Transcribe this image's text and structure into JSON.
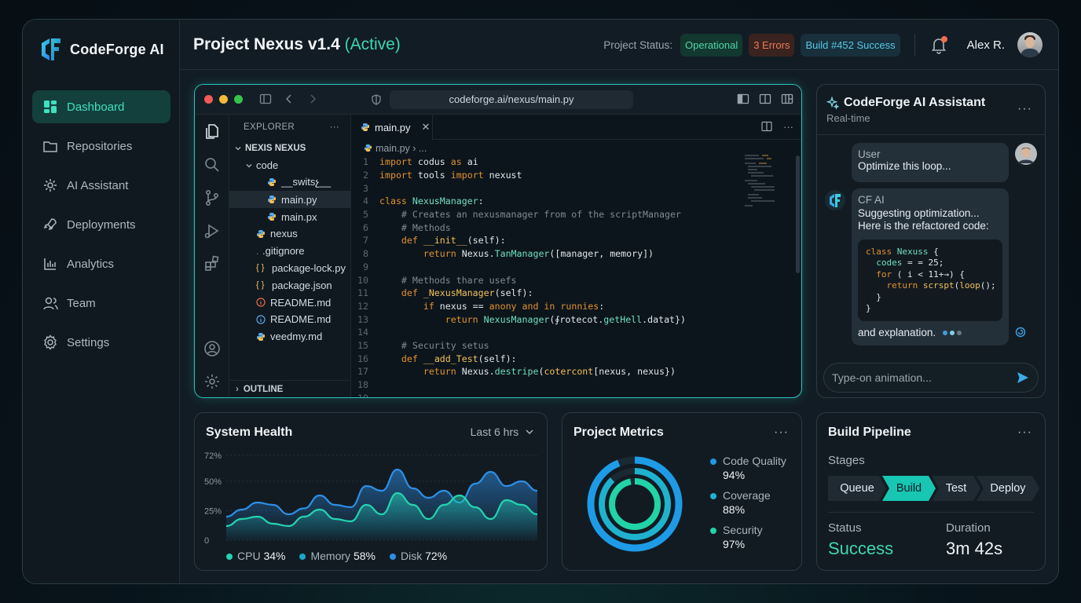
{
  "app": {
    "name": "CodeForge AI"
  },
  "sidebar": {
    "items": [
      {
        "label": "Dashboard",
        "icon": "dashboard-icon",
        "active": true
      },
      {
        "label": "Repositories",
        "icon": "folder-icon"
      },
      {
        "label": "AI Assistant",
        "icon": "cpu-icon"
      },
      {
        "label": "Deployments",
        "icon": "rocket-icon"
      },
      {
        "label": "Analytics",
        "icon": "bar-chart-icon"
      },
      {
        "label": "Team",
        "icon": "users-icon"
      },
      {
        "label": "Settings",
        "icon": "gear-icon"
      }
    ]
  },
  "header": {
    "title": "Project Nexus v1.4",
    "title_status": "(Active)",
    "status_label": "Project Status:",
    "badges": {
      "operational": "Operational",
      "errors": "3 Errors",
      "build": "Build #452 Success"
    },
    "user_name": "Alex R."
  },
  "editor": {
    "url": "codeforge.ai/nexus/main.py",
    "explorer_title": "EXPLORER",
    "explorer_menu": "···",
    "tree": [
      {
        "label": "NEXIS NEXUS",
        "depth": 0,
        "type": "root"
      },
      {
        "label": "code",
        "depth": 1,
        "type": "folder"
      },
      {
        "label": "__switsչ__",
        "depth": 2,
        "type": "py"
      },
      {
        "label": "main.py",
        "depth": 2,
        "type": "py",
        "selected": true
      },
      {
        "label": "main.px",
        "depth": 2,
        "type": "py"
      },
      {
        "label": "nexus",
        "depth": 1,
        "type": "py"
      },
      {
        "label": ".gitignore",
        "depth": 1,
        "type": "git"
      },
      {
        "label": "package-lock.py",
        "depth": 1,
        "type": "json"
      },
      {
        "label": "package.json",
        "depth": 1,
        "type": "json"
      },
      {
        "label": "README.md",
        "depth": 1,
        "type": "readme-red"
      },
      {
        "label": "README.md",
        "depth": 1,
        "type": "readme-blue"
      },
      {
        "label": "veedmy.md",
        "depth": 1,
        "type": "py"
      }
    ],
    "outline_label": "OUTLINE",
    "tab_label": "main.py",
    "tab_close": "✕",
    "tab_more": "···",
    "breadcrumb": "main.py › ...",
    "code_lines": [
      [
        [
          "kw",
          "import"
        ],
        [
          "pl",
          " codus "
        ],
        [
          "kw",
          "as"
        ],
        [
          "pl",
          " ai"
        ]
      ],
      [
        [
          "kw",
          "import"
        ],
        [
          "pl",
          " tools "
        ],
        [
          "kw",
          "import"
        ],
        [
          "pl",
          " nexust"
        ]
      ],
      [],
      [
        [
          "kw",
          "class"
        ],
        [
          "pl",
          " "
        ],
        [
          "cl",
          "NexusManager"
        ],
        [
          "pl",
          ":"
        ]
      ],
      [
        [
          "pl",
          "    "
        ],
        [
          "cm",
          "# Creates an nexusmanager from of the scriptManager"
        ]
      ],
      [
        [
          "pl",
          "    "
        ],
        [
          "cm",
          "# Methods"
        ]
      ],
      [
        [
          "pl",
          "    "
        ],
        [
          "kw",
          "def"
        ],
        [
          "pl",
          " "
        ],
        [
          "fn",
          "__init__"
        ],
        [
          "pl",
          "(self):"
        ]
      ],
      [
        [
          "pl",
          "        "
        ],
        [
          "kw",
          "return"
        ],
        [
          "pl",
          " Nexus."
        ],
        [
          "cl",
          "TanManager"
        ],
        [
          "pl",
          "([manager, memory])"
        ]
      ],
      [],
      [
        [
          "pl",
          "    "
        ],
        [
          "cm",
          "# Methods thare usefs"
        ]
      ],
      [
        [
          "pl",
          "    "
        ],
        [
          "kw",
          "def"
        ],
        [
          "pl",
          " "
        ],
        [
          "fn",
          "_NexusManager"
        ],
        [
          "pl",
          "(self):"
        ]
      ],
      [
        [
          "pl",
          "        "
        ],
        [
          "kw",
          "if"
        ],
        [
          "pl",
          " nexus == "
        ],
        [
          "kw",
          "anony"
        ],
        [
          "pl",
          " "
        ],
        [
          "kw",
          "and in runnies"
        ],
        [
          "pl",
          ":"
        ]
      ],
      [
        [
          "pl",
          "            "
        ],
        [
          "kw",
          "return"
        ],
        [
          "pl",
          " "
        ],
        [
          "cl",
          "NexusManager"
        ],
        [
          "pl",
          "(∮rotecot."
        ],
        [
          "cl",
          "getHell"
        ],
        [
          "pl",
          ".datat})"
        ]
      ],
      [],
      [
        [
          "pl",
          "    "
        ],
        [
          "cm",
          "# Security setus"
        ]
      ],
      [
        [
          "pl",
          "    "
        ],
        [
          "kw",
          "def"
        ],
        [
          "pl",
          " "
        ],
        [
          "fn",
          "__add_Test"
        ],
        [
          "pl",
          "(self):"
        ]
      ],
      [
        [
          "pl",
          "        "
        ],
        [
          "kw",
          "return"
        ],
        [
          "pl",
          " Nexus."
        ],
        [
          "cl",
          "destripe"
        ],
        [
          "pl",
          "("
        ],
        [
          "fn",
          "cotercont"
        ],
        [
          "pl",
          "[nexus, nexus})"
        ]
      ],
      [],
      []
    ]
  },
  "assistant": {
    "title": "CodeForge AI Assistant",
    "subtitle": "Real-time",
    "menu": "···",
    "user_who": "User",
    "user_msg": "Optimize this loop...",
    "ai_who": "CF AI",
    "ai_line1": "Suggesting optimization...",
    "ai_line2": "Here is the refactored code:",
    "ai_code": "class Nexuss {\n  codes = = 25;\n  for ( i < 11+→) {\n    return scrspt(loop();\n  }\n}",
    "ai_tail": "and explanation.",
    "input_placeholder": "Type-on animation..."
  },
  "system_health": {
    "title": "System Health",
    "range": "Last 6 hrs",
    "menu": "···",
    "legend": [
      {
        "label": "CPU",
        "value": "34%",
        "color": "#25d3b0"
      },
      {
        "label": "Memory",
        "value": "58%",
        "color": "#1aa8c9"
      },
      {
        "label": "Disk",
        "value": "72%",
        "color": "#2e8fe6"
      }
    ]
  },
  "chart_data": {
    "type": "area",
    "title": "System Health",
    "y_ticks": [
      "72%",
      "50%",
      "25%",
      "0"
    ],
    "ylim": [
      0,
      72
    ],
    "x": [
      0,
      1,
      2,
      3,
      4,
      5,
      6,
      7,
      8,
      9,
      10,
      11,
      12,
      13,
      14,
      15,
      16,
      17,
      18,
      19,
      20
    ],
    "series": [
      {
        "name": "Memory",
        "color": "#2e8fe6",
        "values": [
          20,
          26,
          32,
          30,
          22,
          27,
          38,
          30,
          28,
          46,
          42,
          60,
          44,
          36,
          42,
          32,
          48,
          58,
          46,
          50,
          42
        ]
      },
      {
        "name": "CPU",
        "color": "#25d3b0",
        "values": [
          12,
          18,
          20,
          14,
          12,
          20,
          26,
          18,
          16,
          30,
          22,
          40,
          30,
          18,
          30,
          38,
          28,
          18,
          34,
          30,
          22
        ]
      }
    ],
    "grid": true
  },
  "metrics": {
    "title": "Project Metrics",
    "menu": "···",
    "items": [
      {
        "label": "Code Quality",
        "value": "94%",
        "pct": 94,
        "color": "#1e9be6"
      },
      {
        "label": "Coverage",
        "value": "88%",
        "pct": 88,
        "color": "#1fb2cf"
      },
      {
        "label": "Security",
        "value": "97%",
        "pct": 97,
        "color": "#22d3a8"
      }
    ]
  },
  "pipeline": {
    "title": "Build Pipeline",
    "menu": "···",
    "stages_label": "Stages",
    "stages": [
      "Queue",
      "Build",
      "Test",
      "Deploy"
    ],
    "active_stage": "Build",
    "status_label": "Status",
    "status_value": "Success",
    "duration_label": "Duration",
    "duration_value": "3m 42s"
  },
  "colors": {
    "accent": "#2cc6c0",
    "success": "#3fd6b0",
    "error": "#ee7a5a"
  }
}
